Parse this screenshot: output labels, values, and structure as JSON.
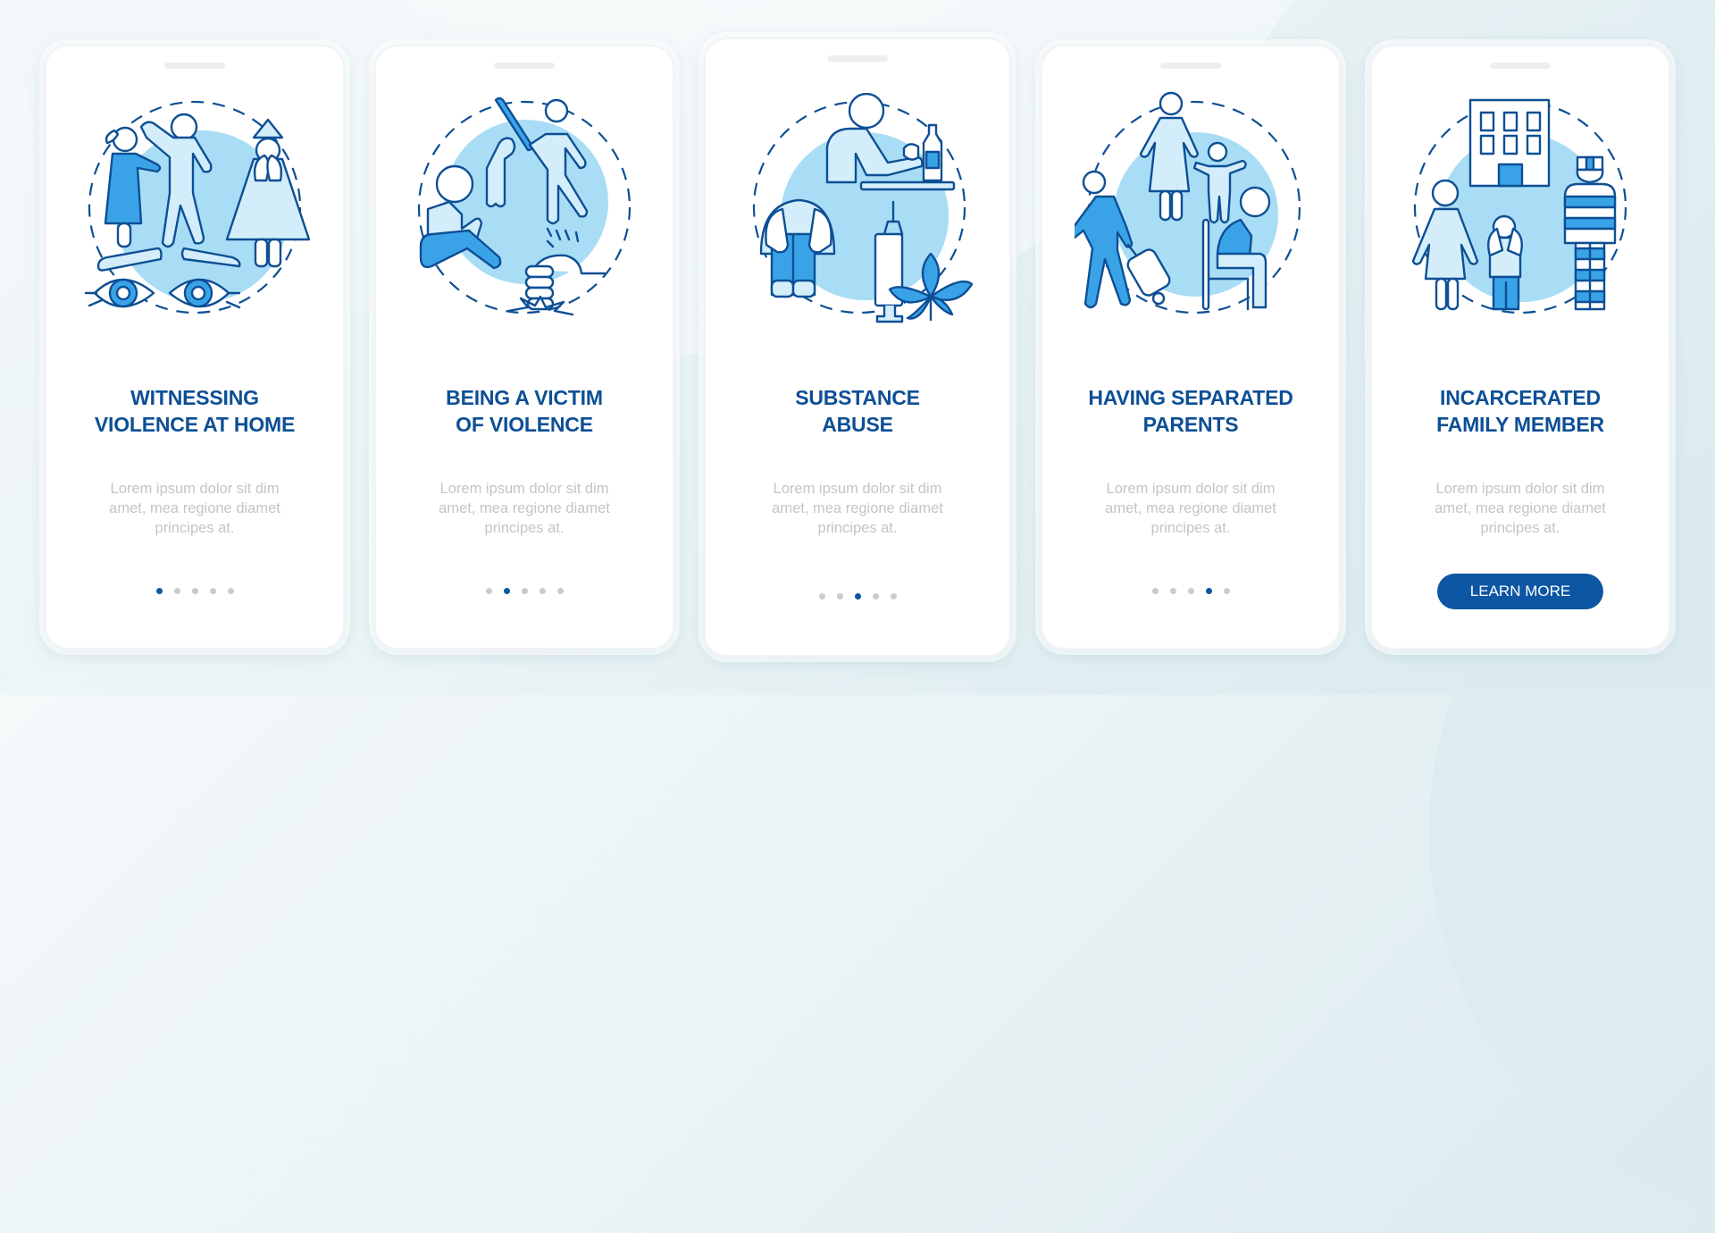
{
  "colors": {
    "title": "#0d4f95",
    "accent": "#0d56a3",
    "body_text": "#c3c5c7",
    "dot_inactive": "#c9cbcd",
    "illustration_stroke": "#0d4f95",
    "illustration_fill_mid": "#3aa3e8",
    "illustration_fill_light": "#d3eefa",
    "illustration_bg_circle": "#a9ddf5"
  },
  "screens": [
    {
      "title_line1": "WITNESSING",
      "title_line2": "VIOLENCE AT HOME",
      "body": "Lorem ipsum dolor sit dim amet, mea regione diamet principes at.",
      "illustration": "witnessing-violence-illustration",
      "page_index": 1,
      "page_count": 5
    },
    {
      "title_line1": "BEING A VICTIM",
      "title_line2": "OF VIOLENCE",
      "body": "Lorem ipsum dolor sit dim amet, mea regione diamet principes at.",
      "illustration": "victim-of-violence-illustration",
      "page_index": 2,
      "page_count": 5
    },
    {
      "title_line1": "SUBSTANCE",
      "title_line2": "ABUSE",
      "body": "Lorem ipsum dolor sit dim amet, mea regione diamet principes at.",
      "illustration": "substance-abuse-illustration",
      "page_index": 3,
      "page_count": 5
    },
    {
      "title_line1": "HAVING SEPARATED",
      "title_line2": "PARENTS",
      "body": "Lorem ipsum dolor sit dim amet, mea regione diamet principes at.",
      "illustration": "separated-parents-illustration",
      "page_index": 4,
      "page_count": 5
    },
    {
      "title_line1": "INCARCERATED",
      "title_line2": "FAMILY MEMBER",
      "body": "Lorem ipsum dolor sit dim amet, mea regione diamet principes at.",
      "illustration": "incarcerated-family-member-illustration",
      "page_index": 5,
      "page_count": 5,
      "button_label": "LEARN MORE"
    }
  ]
}
